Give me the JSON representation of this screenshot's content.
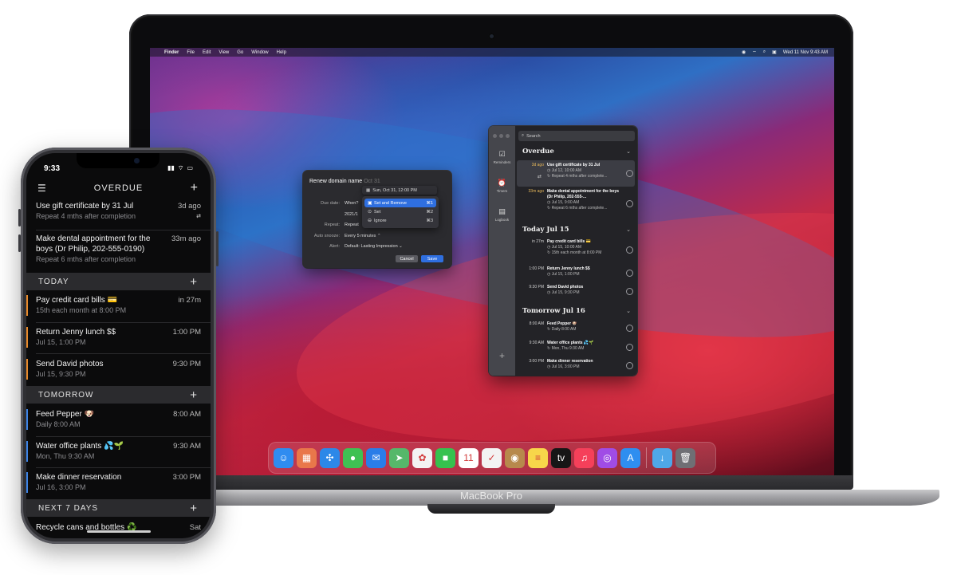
{
  "mac": {
    "label": "MacBook Pro",
    "menubar": {
      "apple": "",
      "items": [
        "Finder",
        "File",
        "Edit",
        "View",
        "Go",
        "Window",
        "Help"
      ],
      "clock": "Wed 11 Nov  9:43 AM",
      "status_icons": [
        "focus-icon",
        "wifi-icon",
        "search-icon",
        "control-center-icon"
      ]
    },
    "dialog": {
      "title": "Renew domain name",
      "title_hint": "Oct 31",
      "popup_value": "Sun, Oct 31, 12:00 PM",
      "menu": [
        {
          "label": "Set and Remove",
          "shortcut": "⌘1",
          "active": true
        },
        {
          "label": "Set",
          "shortcut": "⌘2",
          "active": false
        },
        {
          "label": "Ignore",
          "shortcut": "⌘3",
          "active": false
        }
      ],
      "rows": {
        "due_label": "Due date:",
        "due_value": "When?",
        "date_value": "2021/1",
        "repeat_label": "Repeat:",
        "repeat_value": "Repeat",
        "snooze_label": "Auto snooze:",
        "snooze_value": "Every 5 minutes ⌃",
        "alert_label": "Alert:",
        "alert_value": "Default: Lasting Impression ⌄"
      },
      "cancel": "Cancel",
      "save": "Save"
    },
    "app": {
      "sidebar": [
        {
          "label": "Reminders",
          "icon": "reminders-icon"
        },
        {
          "label": "Timers",
          "icon": "alarm-icon"
        },
        {
          "label": "Logbook",
          "icon": "logbook-icon"
        }
      ],
      "search_placeholder": "Search",
      "sections": [
        {
          "title": "Overdue"
        },
        {
          "title": "Today Jul 15"
        },
        {
          "title": "Tomorrow Jul 16"
        }
      ],
      "reminders": [
        {
          "when": "3d ago",
          "title": "Use gift certificate by 31 Jul",
          "meta1": "Jul 12, 10:00 AM",
          "meta2": "Repeat 4 mths after complete..."
        },
        {
          "when": "33m ago",
          "title": "Make dental appointment for the boys (Dr Philip, 202-555-...",
          "meta1": "Jul 15, 9:00 AM",
          "meta2": "Repeat 6 mths after complete..."
        },
        {
          "when": "in 27m",
          "title": "Pay credit card bills 💳",
          "meta1": "Jul 15, 10:00 AM",
          "meta2": "15th each month at 8:00 PM"
        },
        {
          "when": "1:00 PM",
          "title": "Return Jenny lunch $$",
          "meta1": "Jul 15, 1:00 PM"
        },
        {
          "when": "9:30 PM",
          "title": "Send David photos",
          "meta1": "Jul 15, 9:30 PM"
        },
        {
          "when": "8:00 AM",
          "title": "Feed Pepper 🐶",
          "meta1": "Daily 8:00 AM"
        },
        {
          "when": "9:30 AM",
          "title": "Water office plants 💦🌱",
          "meta1": "Mon, Thu 9:30 AM"
        },
        {
          "when": "3:00 PM",
          "title": "Make dinner reservation",
          "meta1": "Jul 16, 3:00 PM"
        }
      ]
    },
    "dock": [
      {
        "icon": "finder-icon",
        "glyph": "☺",
        "color": "#2f8cf0"
      },
      {
        "icon": "launchpad-icon",
        "glyph": "▦",
        "color": "#e9774a"
      },
      {
        "icon": "safari-icon",
        "glyph": "✣",
        "color": "#2c88e8"
      },
      {
        "icon": "messages-icon",
        "glyph": "●",
        "color": "#3fc153"
      },
      {
        "icon": "mail-icon",
        "glyph": "✉",
        "color": "#2a7de8"
      },
      {
        "icon": "maps-icon",
        "glyph": "➤",
        "color": "#56b86a"
      },
      {
        "icon": "photos-icon",
        "glyph": "✿",
        "color": "#f3f3f3"
      },
      {
        "icon": "facetime-icon",
        "glyph": "■",
        "color": "#36c24e"
      },
      {
        "icon": "calendar-icon",
        "glyph": "11",
        "color": "#ffffff"
      },
      {
        "icon": "due-app-icon",
        "glyph": "✓",
        "color": "#f3f3f3"
      },
      {
        "icon": "contacts-icon",
        "glyph": "◉",
        "color": "#b7894c"
      },
      {
        "icon": "notes-icon",
        "glyph": "≡",
        "color": "#f7d64a"
      },
      {
        "icon": "tv-icon",
        "glyph": "tv",
        "color": "#161616"
      },
      {
        "icon": "music-icon",
        "glyph": "♫",
        "color": "#f5405a"
      },
      {
        "icon": "podcasts-icon",
        "glyph": "◎",
        "color": "#a04ce6"
      },
      {
        "icon": "app-store-icon",
        "glyph": "A",
        "color": "#2e8ef0"
      },
      {
        "icon": "downloads-folder-icon",
        "glyph": "↓",
        "color": "#4ea7e8"
      },
      {
        "icon": "trash-icon",
        "glyph": "🗑",
        "color": "#6f6f74"
      }
    ]
  },
  "iphone": {
    "time": "9:33",
    "title": "OVERDUE",
    "sections": {
      "today": "TODAY",
      "tomorrow": "TOMORROW",
      "next7": "NEXT 7 DAYS"
    },
    "overdue": [
      {
        "title": "Use gift certificate by 31 Jul",
        "right": "3d ago",
        "sub": "Repeat 4 mths after completion",
        "sub_right": "⇄"
      },
      {
        "title": "Make dental appointment for the boys (Dr Philip, 202-555-0190)",
        "right": "33m ago",
        "sub": "Repeat 6 mths after completion"
      }
    ],
    "today": [
      {
        "title": "Pay credit card bills 💳",
        "right": "in 27m",
        "sub": "15th each month at 8:00 PM"
      },
      {
        "title": "Return Jenny lunch $$",
        "right": "1:00 PM",
        "sub": "Jul 15, 1:00 PM"
      },
      {
        "title": "Send David photos",
        "right": "9:30 PM",
        "sub": "Jul 15, 9:30 PM"
      }
    ],
    "tomorrow": [
      {
        "title": "Feed Pepper 🐶",
        "right": "8:00 AM",
        "sub": "Daily 8:00 AM"
      },
      {
        "title": "Water office plants 💦🌱",
        "right": "9:30 AM",
        "sub": "Mon, Thu 9:30 AM"
      },
      {
        "title": "Make dinner reservation",
        "right": "3:00 PM",
        "sub": "Jul 16, 3:00 PM"
      }
    ],
    "next7": [
      {
        "title": "Recycle cans and bottles ♻️",
        "right": "Sat"
      }
    ]
  }
}
